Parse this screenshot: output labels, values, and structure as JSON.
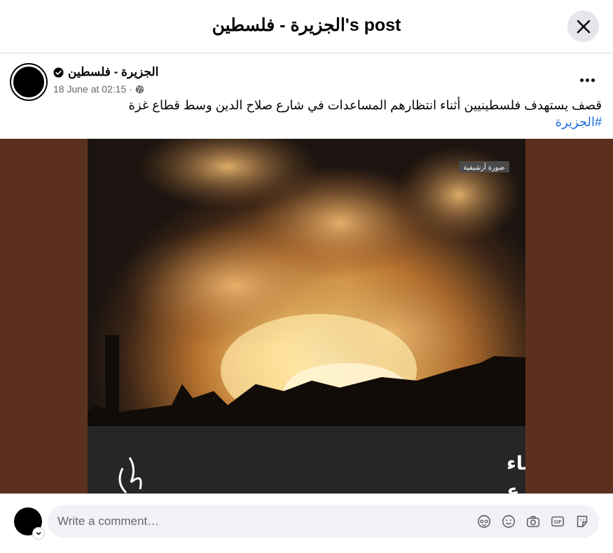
{
  "dialog": {
    "title": "الجزيرة - فلسطين's post"
  },
  "post": {
    "author": "الجزيرة - فلسطين",
    "timestamp": "18 June at 02:15",
    "separator": "·",
    "caption": "قصف يستهدف فلسطينيين أثناء انتظارهم المساعدات في شارع صلاح الدين وسط قطاع غزة",
    "hashtag": "#الجزيرة"
  },
  "image": {
    "archive_label": "صورة أرشيفية",
    "headline_line1": "قصف يستهدف فلسطينيين أثناء",
    "headline_line2": "انتظارهم المساعدات في شارع"
  },
  "composer": {
    "placeholder": "Write a comment…",
    "icons": [
      "avatar-sticker-icon",
      "emoji-icon",
      "camera-icon",
      "gif-icon",
      "sticker-icon"
    ]
  },
  "colors": {
    "media_background": "#5b311e",
    "link": "#216fdb",
    "secondary_text": "#65676b"
  }
}
